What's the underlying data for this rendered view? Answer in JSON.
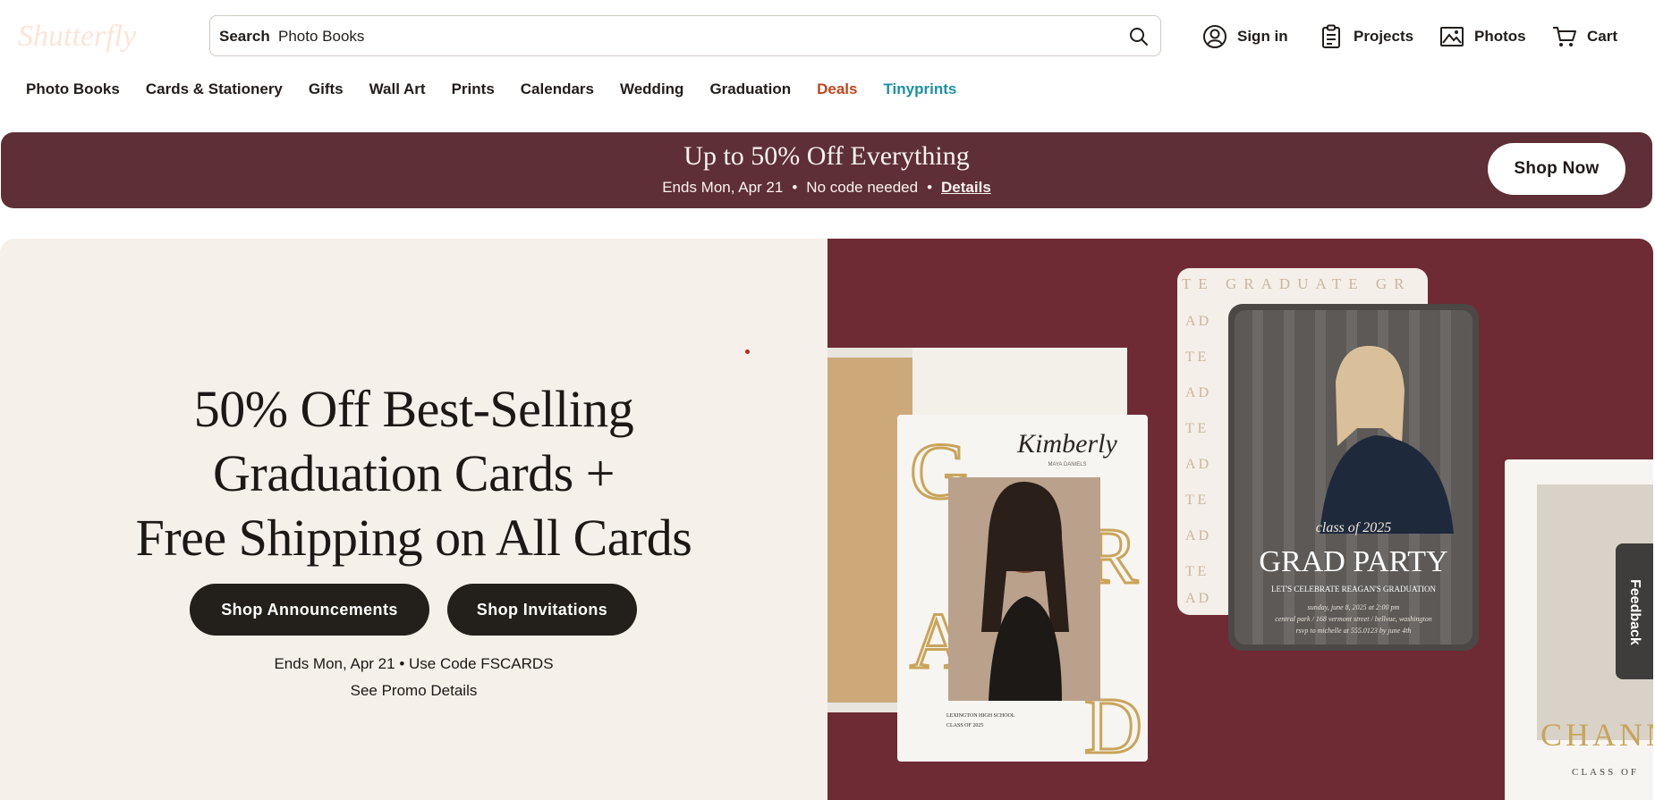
{
  "header": {
    "logo_text": "Shutterfly",
    "search_label": "Search",
    "search_value": "Photo Books",
    "sign_in": "Sign in",
    "projects": "Projects",
    "photos": "Photos",
    "cart": "Cart"
  },
  "categories": [
    "Photo Books",
    "Cards & Stationery",
    "Gifts",
    "Wall Art",
    "Prints",
    "Calendars",
    "Wedding",
    "Graduation",
    "Deals",
    "Tinyprints"
  ],
  "promo_band": {
    "title": "Up to 50% Off Everything",
    "ends": "Ends Mon, Apr 21",
    "no_code": "No code needed",
    "details": "Details",
    "cta": "Shop Now"
  },
  "hero": {
    "title_line1": "50% Off Best-Selling",
    "title_line2": "Graduation Cards +",
    "title_line3": "Free Shipping on All Cards",
    "btn_announcements": "Shop Announcements",
    "btn_invitations": "Shop Invitations",
    "ends": "Ends Mon, Apr 21 • Use Code FSCARDS",
    "promo_details": "See Promo Details"
  },
  "cards": {
    "kimberly": "Kimberly",
    "kimberly_sub": "MAYA DANIELS",
    "school_line1": "LEXINGTON HIGH SCHOOL",
    "school_line2": "CLASS OF 2025",
    "graduate_pattern": "TE GRADUATE GR",
    "class_of": "class of 2025",
    "grad_party": "GRAD PARTY",
    "celebrate": "LET'S CELEBRATE REAGAN'S GRADUATION",
    "party_line1": "sunday, june 8, 2025 at 2:00 pm",
    "party_line2": "central park / 168 vermont street / bellvue, washington",
    "party_line3": "rsvp to michelle at 555.0123 by june 4th",
    "chann": "CHANN",
    "class_of_right": "CLASS OF"
  },
  "feedback": "Feedback",
  "colors": {
    "band": "#5e2f36",
    "hero_left_bg": "#f5f0ea",
    "hero_right_bg": "#6e2b34",
    "deals": "#c0461c",
    "tinyprints": "#1f8fa1",
    "button_dark": "#23201b"
  }
}
